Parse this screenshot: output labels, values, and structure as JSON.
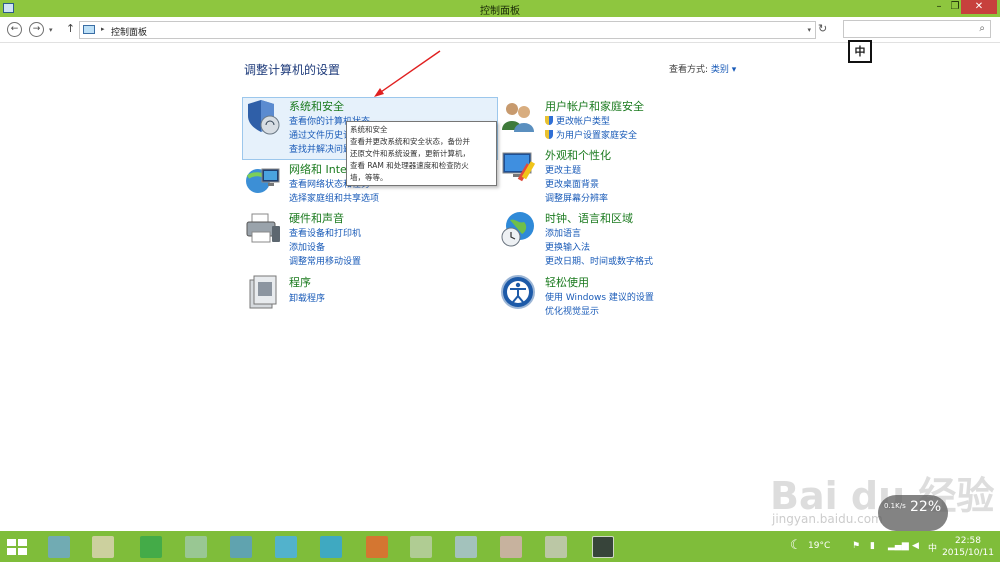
{
  "window": {
    "title": "控制面板",
    "min_label": "–",
    "max_label": "❐",
    "close_label": "✕"
  },
  "nav": {
    "back_label": "←",
    "forward_label": "→",
    "dropdown_label": "▾",
    "up_label": "↑",
    "breadcrumb_sep": "▸",
    "path": "控制面板",
    "address_dropdown": "▾",
    "refresh_label": "↻",
    "search_placeholder": "",
    "search_icon": "⌕"
  },
  "ime": "中",
  "main": {
    "heading": "调整计算机的设置",
    "view_by_label": "查看方式:",
    "view_by_value": "类别 ▾"
  },
  "categories": [
    {
      "title": "系统和安全",
      "links": [
        "查看你的计算机状态",
        "通过文件历史记录保存你的文件备份副本",
        "查找并解决问题"
      ],
      "icon": "shield-icon"
    },
    {
      "title": "网络和 Internet",
      "links": [
        "查看网络状态和任务",
        "选择家庭组和共享选项"
      ],
      "icon": "network-icon"
    },
    {
      "title": "硬件和声音",
      "links": [
        "查看设备和打印机",
        "添加设备",
        "调整常用移动设置"
      ],
      "icon": "printer-icon"
    },
    {
      "title": "程序",
      "links": [
        "卸载程序"
      ],
      "icon": "programs-icon"
    },
    {
      "title": "用户帐户和家庭安全",
      "links": [
        "更改帐户类型",
        "为用户设置家庭安全"
      ],
      "icon": "users-icon"
    },
    {
      "title": "外观和个性化",
      "links": [
        "更改主题",
        "更改桌面背景",
        "调整屏幕分辨率"
      ],
      "icon": "appearance-icon"
    },
    {
      "title": "时钟、语言和区域",
      "links": [
        "添加语言",
        "更换输入法",
        "更改日期、时间或数字格式"
      ],
      "icon": "globe-clock-icon"
    },
    {
      "title": "轻松使用",
      "links": [
        "使用 Windows 建议的设置",
        "优化视觉显示"
      ],
      "icon": "ease-of-access-icon"
    }
  ],
  "tooltip": {
    "title": "系统和安全",
    "body_lines": [
      "查看并更改系统和安全状态，备份并",
      "还原文件和系统设置，更新计算机，",
      "查看 RAM 和处理器速度和检查防火",
      "墙，等等。"
    ]
  },
  "taskbar": {
    "temperature": "19°C",
    "ime": "中",
    "time": "22:58",
    "date": "2015/10/11"
  },
  "overlay": {
    "watermark": "Bai du 经验",
    "watermark_url": "jingyan.baidu.com",
    "gauge_pct": "22%",
    "gauge_rate": "0.1K/s"
  }
}
